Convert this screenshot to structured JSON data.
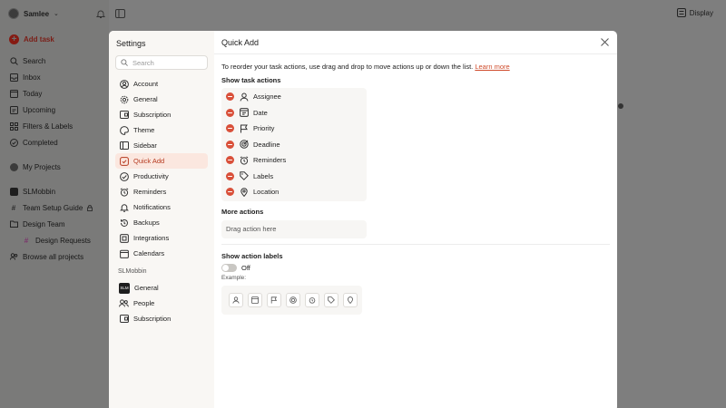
{
  "background": {
    "user_name": "Samlee",
    "add_task_label": "Add task",
    "display_label": "Display",
    "nav": [
      {
        "icon": "search-icon",
        "label": "Search"
      },
      {
        "icon": "inbox-icon",
        "label": "Inbox"
      },
      {
        "icon": "calendar-today-icon",
        "label": "Today"
      },
      {
        "icon": "calendar-upcoming-icon",
        "label": "Upcoming"
      },
      {
        "icon": "filters-icon",
        "label": "Filters & Labels"
      },
      {
        "icon": "check-circle-icon",
        "label": "Completed"
      }
    ],
    "projects_label": "My Projects",
    "workspace_label": "SLMobbin",
    "workspace_items": [
      {
        "icon": "hash-icon",
        "label": "Team Setup Guide"
      },
      {
        "icon": "folder-icon",
        "label": "Design Team"
      },
      {
        "icon": "hash-icon",
        "label": "Design Requests"
      },
      {
        "icon": "people-icon",
        "label": "Browse all projects"
      }
    ]
  },
  "settings": {
    "title": "Settings",
    "search_placeholder": "Search",
    "personal_items": [
      {
        "icon": "account-icon",
        "label": "Account"
      },
      {
        "icon": "gear-icon",
        "label": "General"
      },
      {
        "icon": "subscription-icon",
        "label": "Subscription"
      },
      {
        "icon": "palette-icon",
        "label": "Theme"
      },
      {
        "icon": "sidebar-icon",
        "label": "Sidebar"
      },
      {
        "icon": "quick-add-icon",
        "label": "Quick Add"
      },
      {
        "icon": "productivity-icon",
        "label": "Productivity"
      },
      {
        "icon": "alarm-icon",
        "label": "Reminders"
      },
      {
        "icon": "bell-icon",
        "label": "Notifications"
      },
      {
        "icon": "backup-icon",
        "label": "Backups"
      },
      {
        "icon": "integrations-icon",
        "label": "Integrations"
      },
      {
        "icon": "calendar-icon",
        "label": "Calendars"
      }
    ],
    "active_item": "Quick Add",
    "workspace_section": "SLMobbin",
    "workspace_badge": "SLM",
    "workspace_items": [
      {
        "icon": "workspace-badge-icon",
        "label": "General"
      },
      {
        "icon": "people-icon",
        "label": "People"
      },
      {
        "icon": "subscription-icon",
        "label": "Subscription"
      }
    ]
  },
  "quick_add": {
    "title": "Quick Add",
    "description": "To reorder your task actions, use drag and drop to move actions up or down the list.",
    "learn_more": "Learn more",
    "show_actions_title": "Show task actions",
    "actions": [
      {
        "icon": "assignee-icon",
        "label": "Assignee"
      },
      {
        "icon": "date-icon",
        "label": "Date"
      },
      {
        "icon": "flag-icon",
        "label": "Priority"
      },
      {
        "icon": "deadline-icon",
        "label": "Deadline"
      },
      {
        "icon": "alarm-icon",
        "label": "Reminders"
      },
      {
        "icon": "tag-icon",
        "label": "Labels"
      },
      {
        "icon": "location-pin-icon",
        "label": "Location"
      }
    ],
    "more_actions_title": "More actions",
    "drag_placeholder": "Drag action here",
    "show_labels_title": "Show action labels",
    "toggle_state": "Off",
    "example_label": "Example:"
  },
  "colors": {
    "accent": "#cf4b2b",
    "remove_red": "#d9503a",
    "active_bg": "#fbe7df"
  }
}
